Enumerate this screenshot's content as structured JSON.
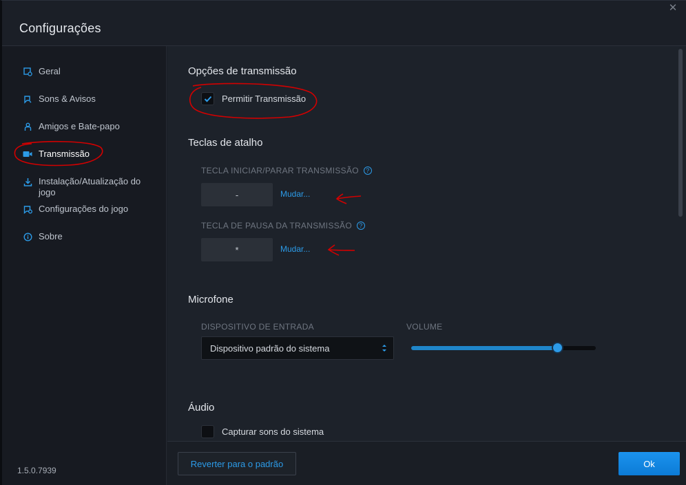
{
  "window": {
    "title": "Configurações"
  },
  "sidebar": {
    "items": [
      {
        "label": "Geral",
        "icon": "settings-icon"
      },
      {
        "label": "Sons & Avisos",
        "icon": "sound-icon"
      },
      {
        "label": "Amigos e Bate-papo",
        "icon": "friends-icon"
      },
      {
        "label": "Transmissão",
        "icon": "camera-icon",
        "active": true
      },
      {
        "label": "Instalação/Atualização do jogo",
        "icon": "download-icon"
      },
      {
        "label": "Configurações do jogo",
        "icon": "game-settings-icon"
      },
      {
        "label": "Sobre",
        "icon": "info-icon"
      }
    ],
    "version": "1.5.0.7939"
  },
  "content": {
    "broadcast_options": {
      "title": "Opções de transmissão",
      "allow_broadcast_label": "Permitir Transmissão",
      "allow_broadcast_checked": true
    },
    "hotkeys": {
      "title": "Teclas de atalho",
      "start_stop_label": "TECLA INICIAR/PARAR TRANSMISSÃO",
      "start_stop_key": "-",
      "pause_label": "TECLA DE PAUSA DA TRANSMISSÃO",
      "pause_key": "*",
      "change_link": "Mudar..."
    },
    "microphone": {
      "title": "Microfone",
      "input_device_label": "DISPOSITIVO DE ENTRADA",
      "input_device_value": "Dispositivo padrão do sistema",
      "volume_label": "VOLUME",
      "volume_level": 0.79
    },
    "audio": {
      "title": "Áudio",
      "capture_system_label": "Capturar sons do sistema",
      "capture_system_checked": false
    }
  },
  "footer": {
    "reset_label": "Reverter para o padrão",
    "ok_label": "Ok"
  },
  "colors": {
    "accent": "#2c9be8",
    "annotation": "#d40000"
  }
}
